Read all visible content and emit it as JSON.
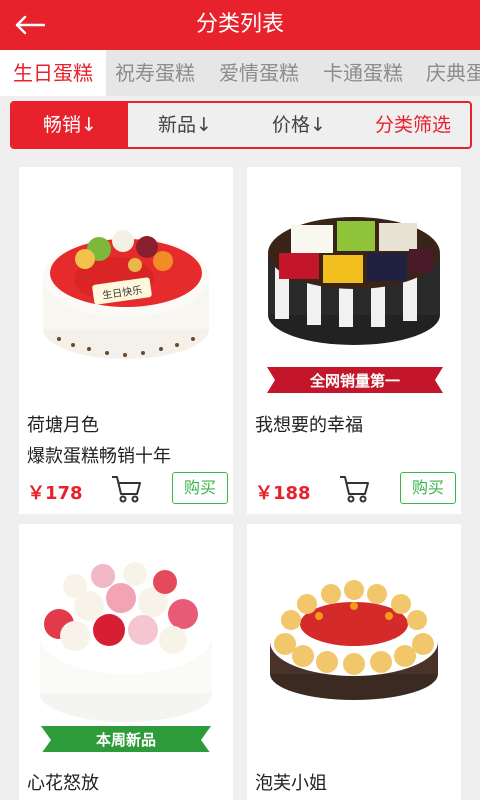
{
  "header": {
    "title": "分类列表"
  },
  "tabs": [
    {
      "label": "生日蛋糕"
    },
    {
      "label": "祝寿蛋糕"
    },
    {
      "label": "爱情蛋糕"
    },
    {
      "label": "卡通蛋糕"
    },
    {
      "label": "庆典蛋"
    }
  ],
  "filters": [
    {
      "label": "畅销↓"
    },
    {
      "label": "新品↓"
    },
    {
      "label": "价格↓"
    },
    {
      "label": "分类筛选"
    }
  ],
  "products": [
    {
      "name": "荷塘月色",
      "subtitle": "爆款蛋糕畅销十年",
      "price": "￥178",
      "buy_label": "购买",
      "image_text": "生日快乐"
    },
    {
      "name": "我想要的幸福",
      "price": "￥188",
      "buy_label": "购买",
      "badge": "全网销量第一"
    },
    {
      "name": "心花怒放",
      "badge": "本周新品"
    },
    {
      "name": "泡芙小姐"
    }
  ],
  "colors": {
    "brand": "#e8222c",
    "buy": "#3bb54a"
  }
}
